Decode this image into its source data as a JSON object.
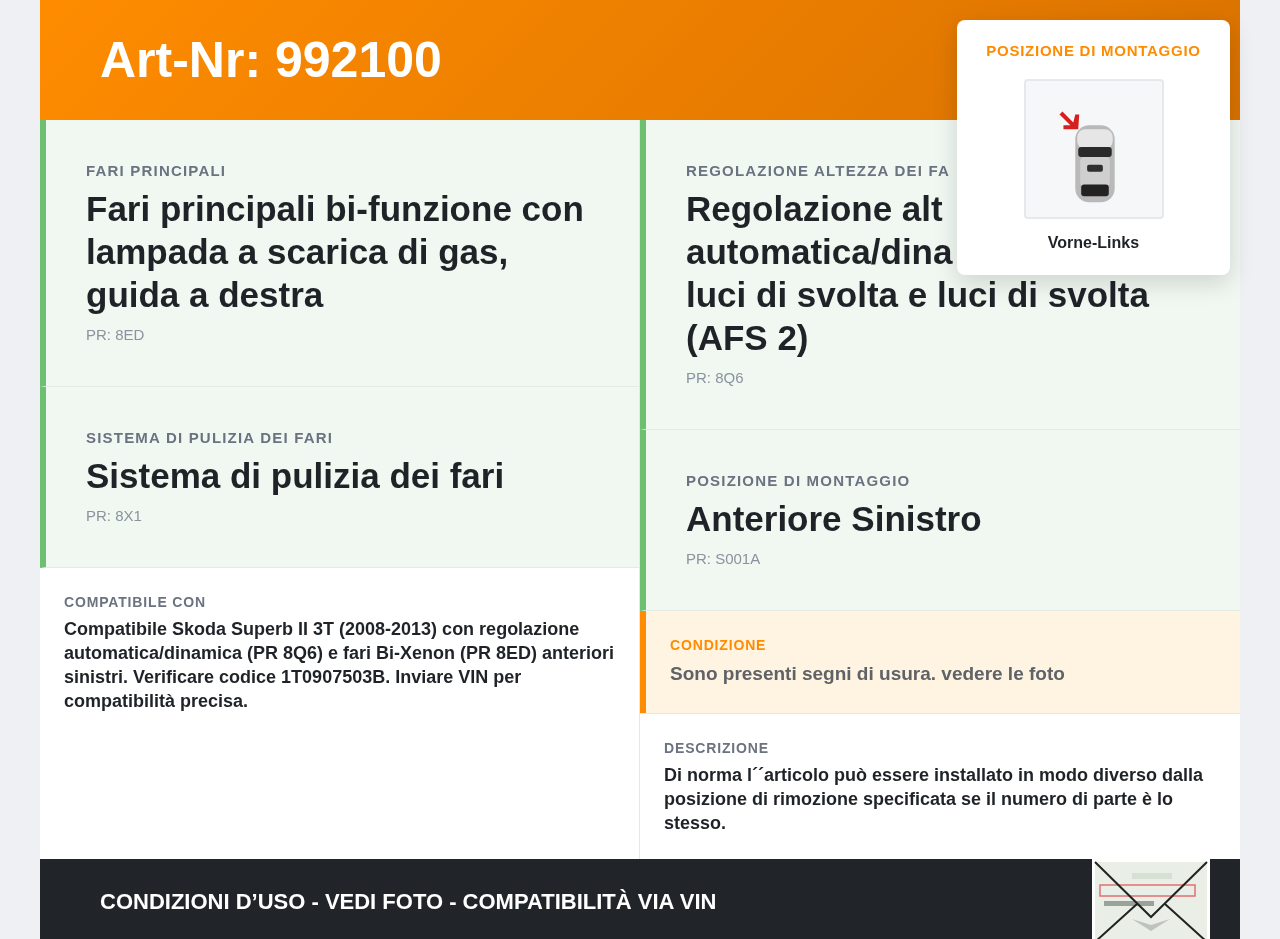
{
  "header": {
    "title": "Art-Nr: 992100"
  },
  "left_cards": [
    {
      "label": "FARI PRINCIPALI",
      "title_lines": [
        "Fari principali bi-funzione con lampada a scarica di gas, guida a destra"
      ],
      "code": "PR: 8ED"
    },
    {
      "label": "SISTEMA DI PULIZIA DEI FARI",
      "title_lines": [
        "Sistema di pulizia dei fari"
      ],
      "code": "PR: 8X1"
    }
  ],
  "compatibility": {
    "label": "COMPATIBILE CON",
    "text": "Compatibile Skoda Superb II 3T (2008-2013) con regolazione automatica/dinamica (PR 8Q6) e fari Bi-Xenon (PR 8ED) anteriori sinistri. Verificare codice 1T0907503B. Inviare VIN per compatibilità precisa."
  },
  "right_cards": [
    {
      "label": "REGOLAZIONE ALTEZZA DEI FA",
      "title_lines": [
        "Regolazione alt",
        "automatica/dina",
        "luci di svolta e luci di svolta",
        "(AFS 2)"
      ],
      "code": "PR: 8Q6"
    },
    {
      "label": "POSIZIONE DI MONTAGGIO",
      "title_lines": [
        "Anteriore Sinistro"
      ],
      "code": "PR: S001A"
    }
  ],
  "condition": {
    "label": "CONDIZIONE",
    "text": "Sono presenti segni di usura. vedere le foto"
  },
  "description": {
    "label": "DESCRIZIONE",
    "text": "Di norma l´´articolo può essere installato in modo diverso dalla posizione di rimozione specificata se il numero di parte è lo stesso."
  },
  "mounting_popup": {
    "title": "POSIZIONE DI MONTAGGIO",
    "caption": "Vorne-Links"
  },
  "footer": {
    "text": "CONDIZIONI D’USO - VEDI FOTO - COMPATIBILITÀ VIA VIN"
  }
}
